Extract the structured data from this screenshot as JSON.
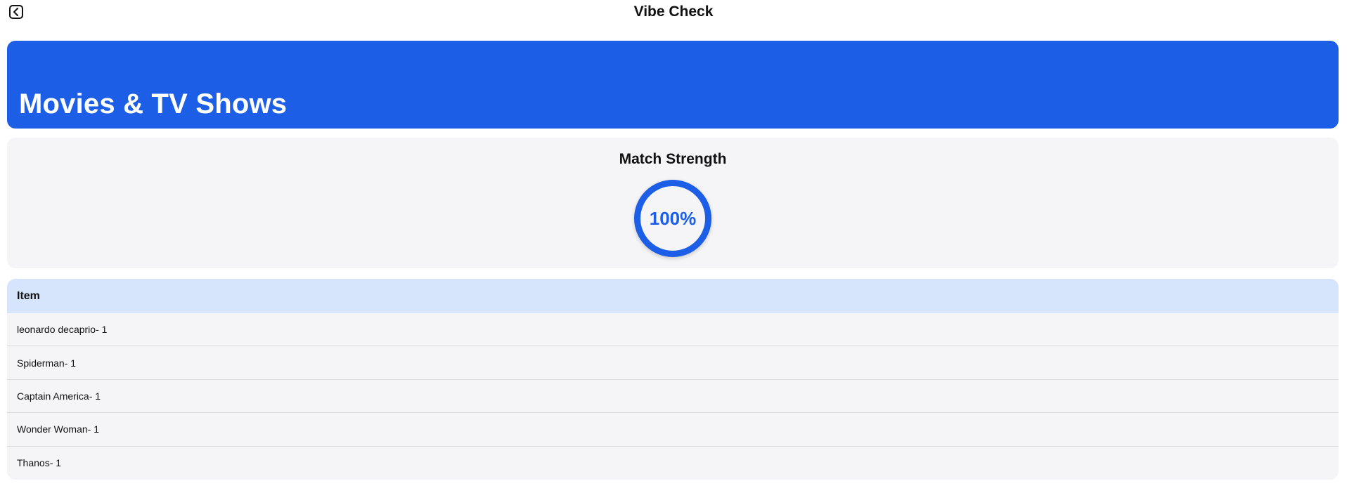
{
  "header": {
    "title": "Vibe Check",
    "back_icon": "chevron-left-icon"
  },
  "banner": {
    "title": "Movies & TV Shows",
    "color": "#1c5ee6"
  },
  "match": {
    "title": "Match Strength",
    "value_label": "100%",
    "value": 100
  },
  "table": {
    "header": "Item",
    "rows": [
      "leonardo decaprio- 1",
      "Spiderman- 1",
      "Captain America- 1",
      "Wonder Woman- 1",
      "Thanos- 1"
    ]
  }
}
